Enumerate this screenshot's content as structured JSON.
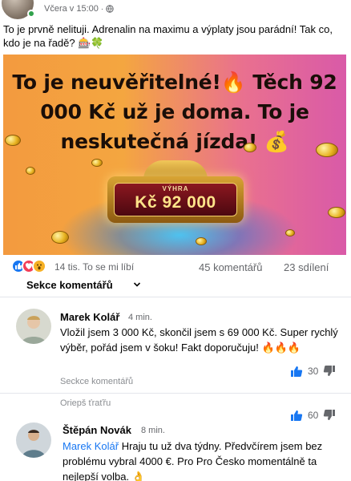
{
  "post": {
    "time": "Včera v 15:00",
    "text": "To je prvně nelituji. Adrenalin na maximu a výplaty jsou parádní! Tak co, kdo je na řadě? 🎰🍀"
  },
  "promo": {
    "headline": "To je neuvěřitelné!🔥 Těch 92 000 Kč už je doma. To je neskutečná jízda! 💰",
    "frame_label": "VÝHRA",
    "frame_amount": "Kč 92 000"
  },
  "engagement": {
    "reactions_text": "14 tis. To se mi líbí",
    "comments": "45 komentářů",
    "shares": "23 sdílení"
  },
  "comments_section": {
    "title": "Sekce komentářů"
  },
  "comments": [
    {
      "name": "Marek Kolář",
      "time": "4 min.",
      "text": "Vložil jsem 3 000 Kč, skončil jsem s 69 000 Kč. Super rychlý výběr, pořád jsem v šoku! Fakt doporučuju! 🔥🔥🔥",
      "action": "Seckce komentářů",
      "likes": "30"
    },
    {
      "name": "Štěpán Novák",
      "time": "8 min.",
      "mention": "Marek Kolář",
      "text": " Hraju tu už dva týdny. Předvčírem jsem bez problému vybral 4000 €. Pro Pro Česko momentálně ta nejlepší volba. 👌",
      "action": "Oriepš ťraťřu",
      "likes": "60"
    }
  ],
  "colors": {
    "link": "#1877f2",
    "like": "#1877f2",
    "love": "#f33e58",
    "wow": "#f7b125"
  }
}
